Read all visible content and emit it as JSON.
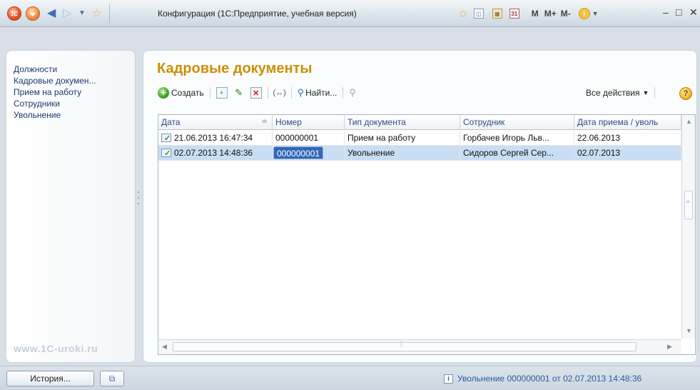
{
  "titlebar": {
    "logo_text": "1C",
    "window_title": "Конфигурация  (1С:Предприятие, учебная версия)",
    "tool_m": "M",
    "tool_mplus": "M+",
    "tool_mminus": "M-",
    "icons": [
      "1c-logo-icon",
      "main-menu-icon",
      "back-icon",
      "forward-icon",
      "history-dropdown-icon",
      "favorites-star-icon",
      "add-favorite-icon",
      "favorites-icon",
      "calculator-icon",
      "calendar-icon",
      "info-icon",
      "minimize-icon",
      "maximize-icon",
      "close-icon"
    ]
  },
  "sidebar": {
    "items": [
      {
        "label": "Должности"
      },
      {
        "label": "Кадровые докумен..."
      },
      {
        "label": "Прием на работу"
      },
      {
        "label": "Сотрудники"
      },
      {
        "label": "Увольнение"
      }
    ],
    "watermark": "www.1C-uroki.ru"
  },
  "form": {
    "title": "Кадровые документы",
    "toolbar": {
      "create_label": "Создать",
      "find_label": "Найти...",
      "all_actions_label": "Все действия",
      "help_label": "?"
    },
    "table": {
      "columns": [
        "Дата",
        "Номер",
        "Тип документа",
        "Сотрудник",
        "Дата приема / уволь"
      ],
      "rows": [
        {
          "date": "21.06.2013 16:47:34",
          "number": "000000001",
          "doc_type": "Прием на работу",
          "employee": "Горбачев Игорь Льв...",
          "hire_fire_date": "22.06.2013"
        },
        {
          "date": "02.07.2013 14:48:36",
          "number": "000000001",
          "doc_type": "Увольнение",
          "employee": "Сидоров Сергей Сер...",
          "hire_fire_date": "02.07.2013"
        }
      ],
      "selected_row_index": 1
    }
  },
  "statusbar": {
    "history_label": "История...",
    "message": "Увольнение 000000001 от 02.07.2013 14:48:36"
  },
  "colors": {
    "title_accent": "#cb8f07",
    "selection": "#c9def3",
    "active_cell": "#3168b8",
    "link_blue": "#2c5aa0"
  }
}
